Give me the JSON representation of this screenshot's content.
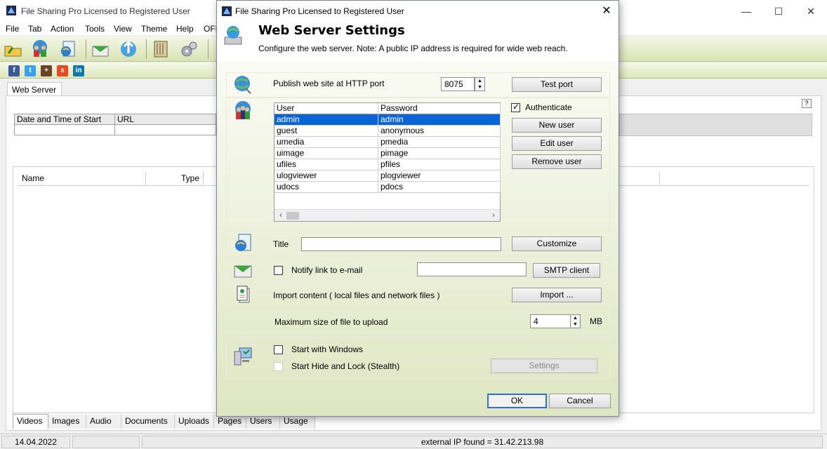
{
  "main": {
    "title": "File Sharing Pro Licensed to Registered User",
    "menu": [
      "File",
      "Tab",
      "Action",
      "Tools",
      "View",
      "Theme",
      "Help",
      "OFF"
    ],
    "tab": "Web Server",
    "help": "?",
    "grid_headers": [
      "Date and Time of Start",
      "URL"
    ],
    "list_headers": [
      "Name",
      "Type"
    ],
    "bottom_tabs": [
      "Videos",
      "Images",
      "Audio",
      "Documents",
      "Uploads",
      "Pages",
      "Users",
      "Usage"
    ],
    "status": {
      "date": "14.04.2022",
      "ip": "external IP found = 31.42.213.98"
    }
  },
  "dialog": {
    "title": "File Sharing Pro Licensed to Registered User",
    "heading": "Web Server Settings",
    "subtext": "Configure the web server. Note: A public IP address is required for wide web reach.",
    "port": {
      "label": "Publish web site at HTTP port",
      "value": "8075",
      "test_button": "Test port"
    },
    "users": {
      "headers": [
        "User",
        "Password"
      ],
      "rows": [
        [
          "admin",
          "admin"
        ],
        [
          "guest",
          "anonymous"
        ],
        [
          "umedia",
          "pmedia"
        ],
        [
          "uimage",
          "pimage"
        ],
        [
          "ufiles",
          "pfiles"
        ],
        [
          "ulogviewer",
          "plogviewer"
        ],
        [
          "udocs",
          "pdocs"
        ]
      ],
      "authenticate": "Authenticate",
      "new_user": "New user",
      "edit_user": "Edit user",
      "remove_user": "Remove user"
    },
    "title_field": {
      "label": "Title",
      "value": "",
      "customize": "Customize"
    },
    "notify": {
      "label": "Notify link to e-mail",
      "value": "",
      "smtp": "SMTP client"
    },
    "import": {
      "label": "Import content ( local files and network files )",
      "button": "Import ..."
    },
    "upload": {
      "label": "Maximum size of file to upload",
      "value": "4",
      "unit": "MB"
    },
    "startup": {
      "start_windows": "Start with Windows",
      "stealth": "Start Hide and Lock (Stealth)",
      "settings": "Settings"
    },
    "ok": "OK",
    "cancel": "Cancel"
  },
  "colors": {
    "accent": "#0a64d6",
    "toolbar_green": "#d9e3b4",
    "ok_border": "#2d70d6"
  }
}
